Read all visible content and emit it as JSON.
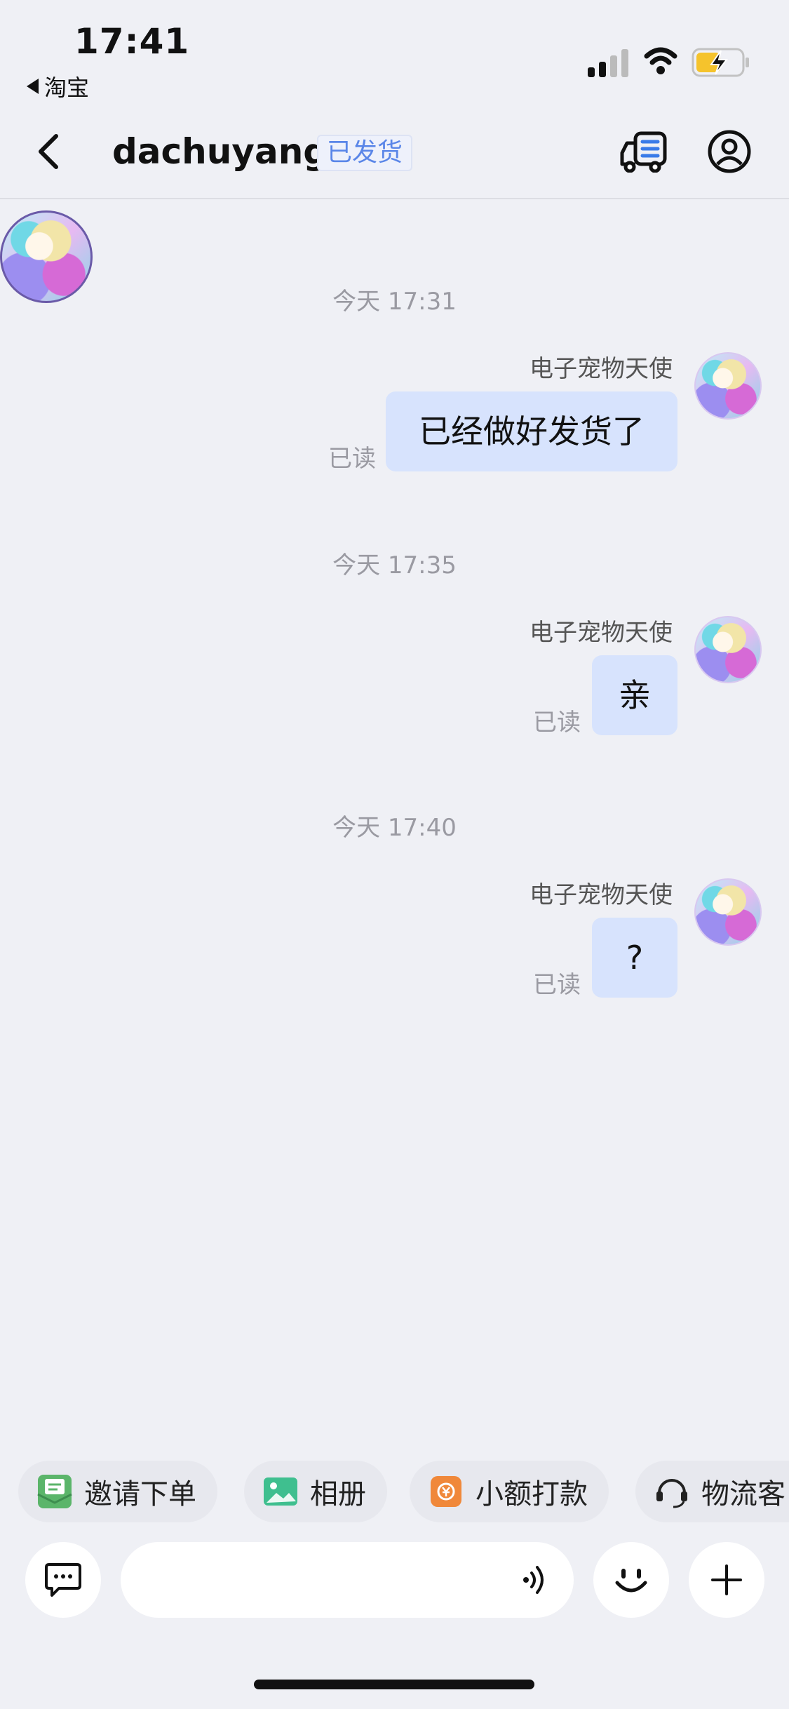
{
  "status_bar": {
    "time": "17:41",
    "back_app": "淘宝"
  },
  "header": {
    "title": "dachuyang",
    "badge": "已发货"
  },
  "messages": [
    {
      "timestamp": "今天 17:31",
      "sender": "电子宠物天使",
      "text": "已经做好发货了",
      "status": "已读"
    },
    {
      "timestamp": "今天 17:35",
      "sender": "电子宠物天使",
      "text": "亲",
      "status": "已读"
    },
    {
      "timestamp": "今天 17:40",
      "sender": "电子宠物天使",
      "text": "?",
      "status": "已读"
    }
  ],
  "quick_tools": [
    {
      "label": "邀请下单",
      "icon": "invite-order-icon",
      "color": "#5bb56a"
    },
    {
      "label": "相册",
      "icon": "album-icon",
      "color": "#3fbf8f"
    },
    {
      "label": "小额打款",
      "icon": "small-payment-icon",
      "color": "#f0883a"
    },
    {
      "label": "物流客",
      "icon": "logistics-service-icon",
      "color": "#222222"
    }
  ],
  "input": {
    "placeholder": ""
  },
  "colors": {
    "bubble": "#d7e3fd",
    "badge": "#5a86e8",
    "background": "#eff0f5"
  }
}
